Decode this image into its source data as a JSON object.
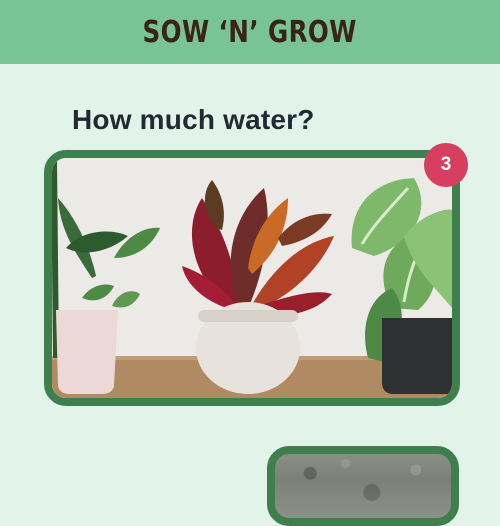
{
  "header": {
    "title": "SOW ‘N’ GROW"
  },
  "question": {
    "text": "How much water?"
  },
  "plant_card": {
    "image_icon": "plant-photo",
    "badge_count": "3"
  },
  "next_card": {
    "image_icon": "stone-texture-photo"
  },
  "colors": {
    "header_bg": "#79c495",
    "page_bg": "#e2f3ea",
    "card_border": "#3f7f4e",
    "badge_bg": "#d63f5f"
  }
}
